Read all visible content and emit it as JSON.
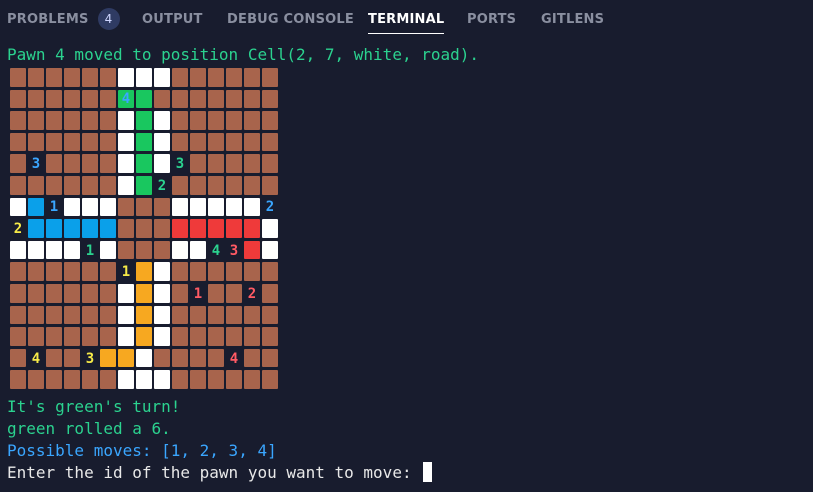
{
  "tabs": [
    {
      "id": "problems",
      "label": "PROBLEMS",
      "badge": "4",
      "active": false
    },
    {
      "id": "output",
      "label": "OUTPUT",
      "active": false
    },
    {
      "id": "debug",
      "label": "DEBUG CONSOLE",
      "active": false
    },
    {
      "id": "terminal",
      "label": "TERMINAL",
      "active": true
    },
    {
      "id": "ports",
      "label": "PORTS",
      "active": false
    },
    {
      "id": "gitlens",
      "label": "GITLENS",
      "active": false
    }
  ],
  "terminal": {
    "first_line": "Pawn 4 moved to position Cell(2, 7, white, road).",
    "lines": [
      {
        "text": "It's green's turn!",
        "color": "green"
      },
      {
        "text": "green rolled a 6.",
        "color": "green"
      },
      {
        "text": "Possible moves: [1, 2, 3, 4]",
        "color": "blue"
      }
    ],
    "prompt": "Enter the id of the pawn you want to move: "
  },
  "colors": {
    "road": "#a8644c",
    "white": "#ffffff",
    "green": "#19c75f",
    "blue": "#0aa0ea",
    "red": "#ef3a3a",
    "yellow": "#f7a820",
    "label_green": "#2bd28f",
    "label_blue": "#3aa6ff",
    "label_red": "#ff5a64",
    "label_yellow": "#f6ea48"
  },
  "board": {
    "legend": "R=road, W=white, G=green, B=blue, r=red, Y=yellow, .=empty",
    "rows": [
      "RRRRRRWWWRRRRRR",
      "RRRRRRGGRRRRRRR",
      "RRRRRRWGWRRRRRR",
      "RRRRRRWGWRRRRRR",
      "R.RRRRWGW.RRRRR",
      "RRRRRRWG.RRRRRR",
      "WB.WWWRRRWWWWW.",
      ".BBBBBRRRrrrrrW",
      "WWWW.WRRRWW..rW",
      "RRRRRR.YWRRRRRR",
      "RRRRRRWYWR.RR.R",
      "RRRRRRWYWRRRRRR",
      "RRRRRRWYWRRRRRR",
      "R.RR.YYWRRRR.RR",
      "RRRRRRWWWRRRRRR"
    ],
    "labels": [
      {
        "r": 1,
        "c": 6,
        "text": "4",
        "color": "label_blue",
        "over": true
      },
      {
        "r": 4,
        "c": 1,
        "text": "3",
        "color": "label_blue"
      },
      {
        "r": 4,
        "c": 9,
        "text": "3",
        "color": "label_green"
      },
      {
        "r": 5,
        "c": 8,
        "text": "2",
        "color": "label_green"
      },
      {
        "r": 6,
        "c": 2,
        "text": "1",
        "color": "label_blue"
      },
      {
        "r": 6,
        "c": 14,
        "text": "2",
        "color": "label_blue"
      },
      {
        "r": 7,
        "c": 0,
        "text": "2",
        "color": "label_yellow"
      },
      {
        "r": 8,
        "c": 4,
        "text": "1",
        "color": "label_green"
      },
      {
        "r": 8,
        "c": 11,
        "text": "4",
        "color": "label_green"
      },
      {
        "r": 8,
        "c": 12,
        "text": "3",
        "color": "label_red"
      },
      {
        "r": 9,
        "c": 6,
        "text": "1",
        "color": "label_yellow"
      },
      {
        "r": 10,
        "c": 10,
        "text": "1",
        "color": "label_red"
      },
      {
        "r": 10,
        "c": 13,
        "text": "2",
        "color": "label_red"
      },
      {
        "r": 13,
        "c": 1,
        "text": "4",
        "color": "label_yellow"
      },
      {
        "r": 13,
        "c": 4,
        "text": "3",
        "color": "label_yellow"
      },
      {
        "r": 13,
        "c": 12,
        "text": "4",
        "color": "label_red"
      }
    ]
  }
}
